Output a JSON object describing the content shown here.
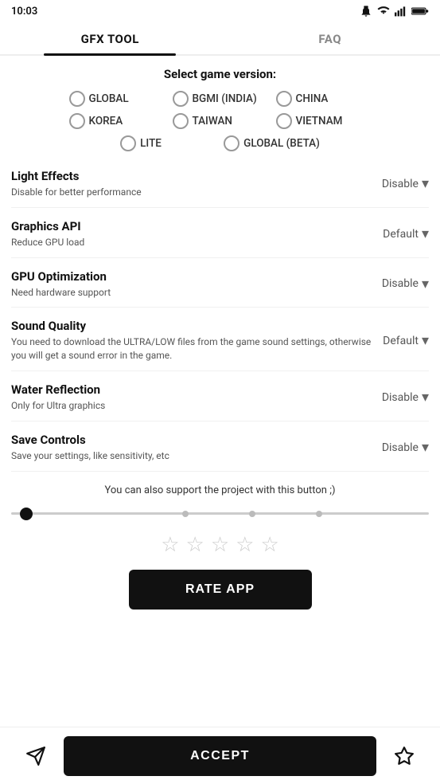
{
  "status_bar": {
    "time": "10:03",
    "icons": [
      "notification",
      "wifi",
      "signal",
      "battery"
    ]
  },
  "tabs": [
    {
      "id": "gfx-tool",
      "label": "GFX TOOL",
      "active": true
    },
    {
      "id": "faq",
      "label": "FAQ",
      "active": false
    }
  ],
  "version_section": {
    "title": "Select game version:",
    "options": [
      {
        "id": "global",
        "label": "GLOBAL",
        "checked": false
      },
      {
        "id": "bgmi",
        "label": "BGMI (INDIA)",
        "checked": false
      },
      {
        "id": "china",
        "label": "CHINA",
        "checked": false
      },
      {
        "id": "korea",
        "label": "KOREA",
        "checked": false
      },
      {
        "id": "taiwan",
        "label": "TAIWAN",
        "checked": false
      },
      {
        "id": "vietnam",
        "label": "VIETNAM",
        "checked": false
      },
      {
        "id": "lite",
        "label": "LITE",
        "checked": false
      },
      {
        "id": "global-beta",
        "label": "GLOBAL (BETA)",
        "checked": false
      }
    ]
  },
  "settings": [
    {
      "id": "light-effects",
      "title": "Light Effects",
      "description": "Disable for better performance",
      "value": "Disable"
    },
    {
      "id": "graphics-api",
      "title": "Graphics API",
      "description": "Reduce GPU load",
      "value": "Default"
    },
    {
      "id": "gpu-optimization",
      "title": "GPU Optimization",
      "description": "Need hardware support",
      "value": "Disable"
    },
    {
      "id": "sound-quality",
      "title": "Sound Quality",
      "description": "You need to download the ULTRA/LOW files from the game sound settings, otherwise you will get a sound error in the game.",
      "value": "Default"
    },
    {
      "id": "water-reflection",
      "title": "Water Reflection",
      "description": "Only for Ultra graphics",
      "value": "Disable"
    },
    {
      "id": "save-controls",
      "title": "Save Controls",
      "description": "Save your settings, like sensitivity, etc",
      "value": "Disable"
    }
  ],
  "support": {
    "text": "You can also support the project with this button ;)",
    "slider": {
      "dots": [
        0.05,
        0.42,
        0.58,
        0.74
      ],
      "thumb_pos": 0.05
    },
    "stars": [
      false,
      false,
      false,
      false,
      false
    ],
    "rate_button_label": "RATE APP"
  },
  "bottom_bar": {
    "accept_label": "ACCEPT",
    "share_icon": "share",
    "bookmark_icon": "star"
  }
}
